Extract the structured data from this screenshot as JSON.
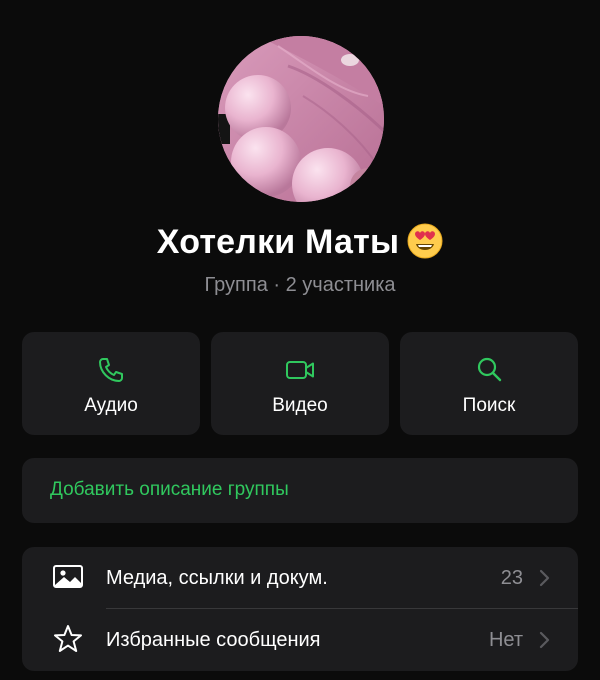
{
  "profile": {
    "group_name": "Хотелки Маты",
    "subtitle": "Группа · 2 участника"
  },
  "actions": [
    {
      "label": "Аудио",
      "icon": "phone-icon"
    },
    {
      "label": "Видео",
      "icon": "video-camera-icon"
    },
    {
      "label": "Поиск",
      "icon": "search-icon"
    }
  ],
  "description": {
    "link": "Добавить описание группы"
  },
  "list": [
    {
      "label": "Медиа, ссылки и докум.",
      "value": "23",
      "icon": "photo-icon"
    },
    {
      "label": "Избранные сообщения",
      "value": "Нет",
      "icon": "star-icon"
    }
  ],
  "colors": {
    "accent": "#30c85e",
    "background": "#0b0b0b",
    "card": "#1c1c1e",
    "secondary_text": "#8e8e93"
  }
}
